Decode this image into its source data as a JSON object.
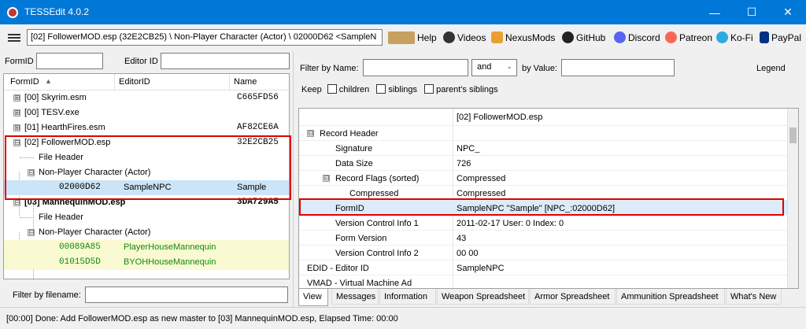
{
  "app": {
    "title": "TESSEdit 4.0.2"
  },
  "window_controls": {
    "minimize": "—",
    "maximize": "☐",
    "close": "✕"
  },
  "toolbar": {
    "path": "[02] FollowerMOD.esp (32E2CB25) \\ Non-Player Character (Actor) \\ 02000D62 <SampleN",
    "links": [
      "Help",
      "Videos",
      "NexusMods",
      "GitHub",
      "Discord",
      "Patreon",
      "Ko-Fi",
      "PayPal"
    ]
  },
  "left": {
    "formid_label": "FormID",
    "editorid_label": "Editor ID",
    "columns": [
      "FormID",
      "EditorID",
      "Name"
    ],
    "sort_indicator": "▲",
    "rows": [
      {
        "formid": "[00] Skyrim.esm",
        "editorid": "",
        "name": "C665FD56",
        "expander": "⊞"
      },
      {
        "formid": "[00] TESV.exe",
        "editorid": "",
        "name": "",
        "expander": "⊞"
      },
      {
        "formid": "[01] HearthFires.esm",
        "editorid": "",
        "name": "AF82CE6A",
        "expander": "⊞"
      },
      {
        "formid": "[02] FollowerMOD.esp",
        "editorid": "",
        "name": "32E2CB25",
        "expander": "⊟"
      },
      {
        "formid": "File Header",
        "editorid": "",
        "name": "",
        "expander": ""
      },
      {
        "formid": "Non-Player Character (Actor)",
        "editorid": "",
        "name": "",
        "expander": "⊟"
      },
      {
        "formid": "02000D62",
        "editorid": "SampleNPC",
        "name": "Sample",
        "expander": ""
      },
      {
        "formid": "[03] MannequinMOD.esp",
        "editorid": "",
        "name": "3DA729A5",
        "expander": "⊟"
      },
      {
        "formid": "File Header",
        "editorid": "",
        "name": "",
        "expander": ""
      },
      {
        "formid": "Non-Player Character (Actor)",
        "editorid": "",
        "name": "",
        "expander": "⊟"
      },
      {
        "formid": "00089A85",
        "editorid": "PlayerHouseMannequin",
        "name": "",
        "expander": ""
      },
      {
        "formid": "01015D5D",
        "editorid": "BYOHHouseMannequin",
        "name": "",
        "expander": ""
      }
    ],
    "filter_label": "Filter by filename:"
  },
  "right": {
    "filter_name_label": "Filter by Name:",
    "and_select": "and",
    "by_value_label": "by Value:",
    "legend": "Legend",
    "keep_label": "Keep",
    "children_label": "children",
    "siblings_label": "siblings",
    "parents_siblings_label": "parent's siblings",
    "grid_header_value": "[02] FollowerMOD.esp",
    "grid_rows": [
      {
        "label": "Record Header",
        "value": "",
        "expander": "⊟"
      },
      {
        "label": "Signature",
        "value": "NPC_",
        "expander": ""
      },
      {
        "label": "Data Size",
        "value": "726",
        "expander": ""
      },
      {
        "label": "Record Flags (sorted)",
        "value": "Compressed",
        "expander": "⊟"
      },
      {
        "label": "Compressed",
        "value": "Compressed",
        "expander": ""
      },
      {
        "label": "FormID",
        "value": "SampleNPC \"Sample\" [NPC_:02000D62]",
        "expander": ""
      },
      {
        "label": "Version Control Info 1",
        "value": "2011-02-17 User: 0 Index: 0",
        "expander": ""
      },
      {
        "label": "Form Version",
        "value": "43",
        "expander": ""
      },
      {
        "label": "Version Control Info 2",
        "value": "00 00",
        "expander": ""
      },
      {
        "label": "EDID - Editor ID",
        "value": "SampleNPC",
        "expander": ""
      },
      {
        "label": "VMAD - Virtual Machine Ad",
        "value": "",
        "expander": ""
      }
    ],
    "tabs": [
      "View",
      "Messages",
      "Information",
      "Weapon Spreadsheet",
      "Armor Spreadsheet",
      "Ammunition Spreadsheet",
      "What's New"
    ]
  },
  "status": {
    "text": "[00:00] Done: Add FollowerMOD.esp as new master to [03] MannequinMOD.esp, Elapsed Time: 00:00"
  }
}
